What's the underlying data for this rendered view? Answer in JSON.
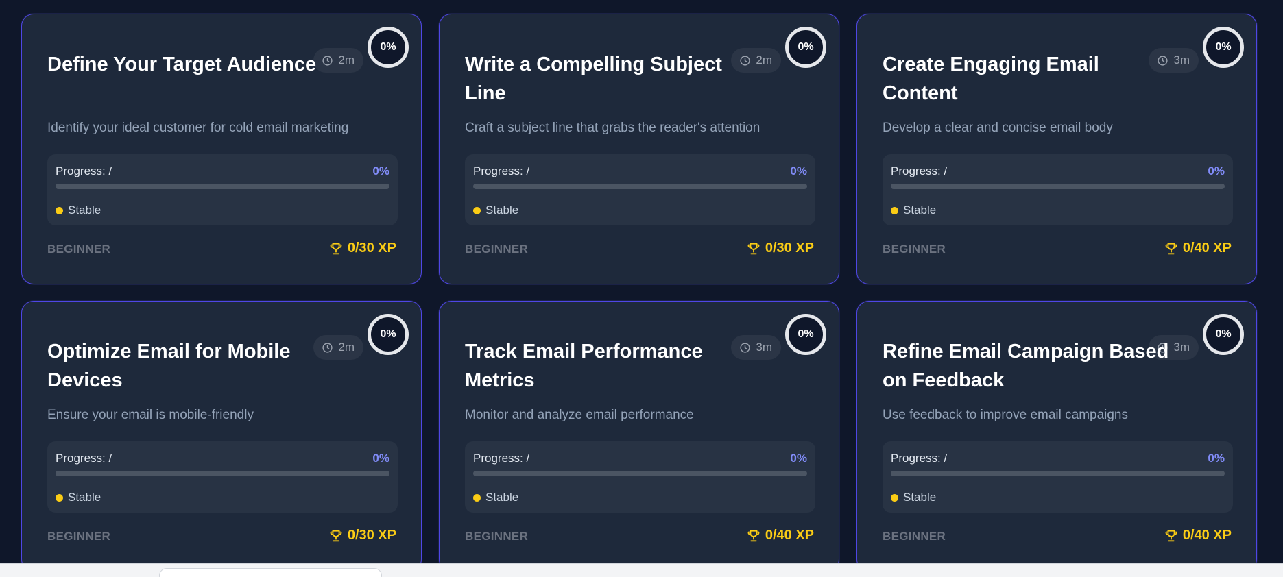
{
  "accent": "#4f46e5",
  "status_dot_color": "#facc15",
  "cards": [
    {
      "title": "Define Your Target Audience",
      "description": "Identify your ideal customer for cold email marketing",
      "time": "2m",
      "completion": "0%",
      "progress_label": "Progress: /",
      "progress_percent": "0%",
      "progress_value": 0,
      "status": "Stable",
      "level": "BEGINNER",
      "xp": "0/30 XP"
    },
    {
      "title": "Write a Compelling Subject Line",
      "description": "Craft a subject line that grabs the reader's attention",
      "time": "2m",
      "completion": "0%",
      "progress_label": "Progress: /",
      "progress_percent": "0%",
      "progress_value": 0,
      "status": "Stable",
      "level": "BEGINNER",
      "xp": "0/30 XP"
    },
    {
      "title": "Create Engaging Email Content",
      "description": "Develop a clear and concise email body",
      "time": "3m",
      "completion": "0%",
      "progress_label": "Progress: /",
      "progress_percent": "0%",
      "progress_value": 0,
      "status": "Stable",
      "level": "BEGINNER",
      "xp": "0/40 XP"
    },
    {
      "title": "Optimize Email for Mobile Devices",
      "description": "Ensure your email is mobile-friendly",
      "time": "2m",
      "completion": "0%",
      "progress_label": "Progress: /",
      "progress_percent": "0%",
      "progress_value": 0,
      "status": "Stable",
      "level": "BEGINNER",
      "xp": "0/30 XP"
    },
    {
      "title": "Track Email Performance Metrics",
      "description": "Monitor and analyze email performance",
      "time": "3m",
      "completion": "0%",
      "progress_label": "Progress: /",
      "progress_percent": "0%",
      "progress_value": 0,
      "status": "Stable",
      "level": "BEGINNER",
      "xp": "0/40 XP"
    },
    {
      "title": "Refine Email Campaign Based on Feedback",
      "description": "Use feedback to improve email campaigns",
      "time": "3m",
      "completion": "0%",
      "progress_label": "Progress: /",
      "progress_percent": "0%",
      "progress_value": 0,
      "status": "Stable",
      "level": "BEGINNER",
      "xp": "0/40 XP"
    }
  ]
}
